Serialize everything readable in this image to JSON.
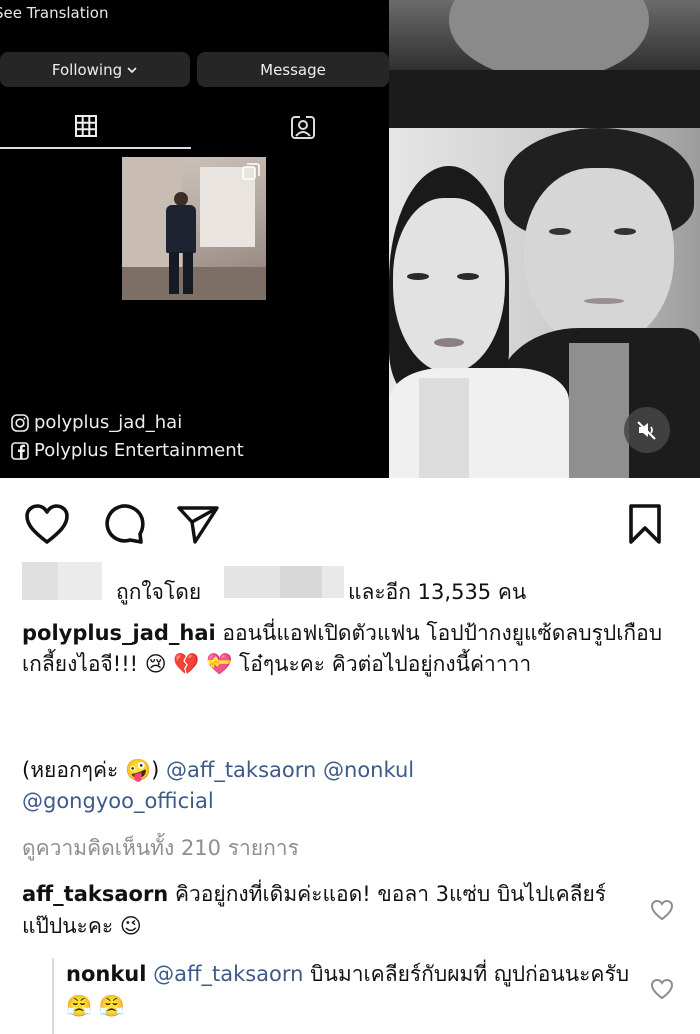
{
  "profile_screenshot": {
    "see_translation": "See Translation",
    "following_label": "Following",
    "message_label": "Message",
    "credit_instagram": "polyplus_jad_hai",
    "credit_facebook": "Polyplus Entertainment"
  },
  "post": {
    "likes_prefix": "ถูกใจโดย",
    "likes_suffix": "และอีก 13,535 คน",
    "caption_user": "polyplus_jad_hai",
    "caption_text_1": " ออนนี่แอฟเปิดตัวแฟน โอปป้ากงยูแซ้ดลบรูปเกือบเกลี้ยงไอจี!!! ",
    "caption_emojis_1": "😢 💔 💝",
    "caption_text_2": " โอ๋ๆนะคะ คิวต่อไปอยู่กงนี้ค่าาาา",
    "caption_line2_prefix": "(หยอกๆค่ะ ",
    "caption_line2_emoji": "🤪",
    "caption_line2_suffix": ") ",
    "mention_1": "@aff_taksaorn",
    "mention_2": "@nonkul",
    "mention_3": "@gongyoo_official",
    "view_all_comments": "ดูความคิดเห็นทั้ง 210 รายการ"
  },
  "comments": [
    {
      "user": "aff_taksaorn",
      "text": " คิวอยู่กงที่เดิมค่ะแอด! ขอลา 3แซ่บ บินไปเคลียร์แป๊ปนะคะ ",
      "emoji": "😉"
    },
    {
      "user": "nonkul",
      "mention": "@aff_taksaorn",
      "text": " บินมาเคลียร์กับผมที่ ญูปก่อนนะครับ ",
      "emoji": "😤 😤"
    }
  ],
  "icons": {
    "heart": "heart-icon",
    "comment": "comment-icon",
    "share": "share-icon",
    "bookmark": "bookmark-icon",
    "mute": "speaker-mute-icon",
    "grid": "grid-icon",
    "tagged": "tagged-icon",
    "multi": "multiple-photos-icon",
    "instagram": "instagram-icon",
    "facebook": "facebook-icon"
  },
  "colors": {
    "mention": "#3d5a8a",
    "muted_text": "#8e8e8e",
    "dark_button": "#262626"
  }
}
